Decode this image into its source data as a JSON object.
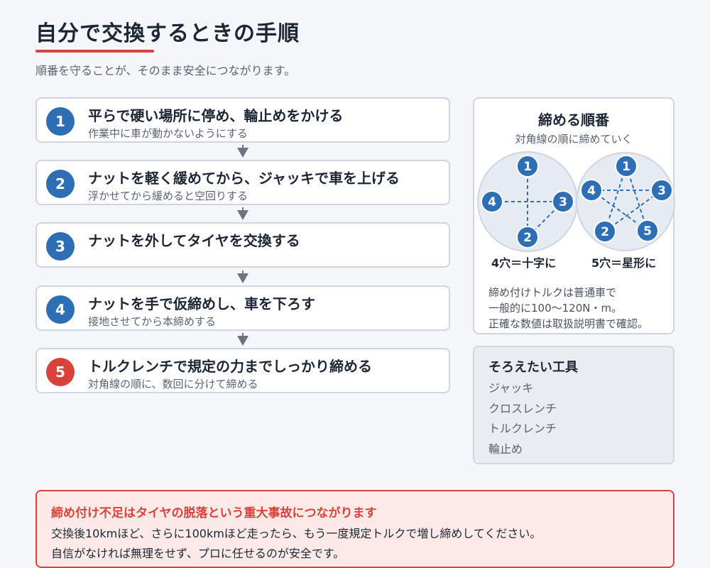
{
  "header": {
    "title": "自分で交換するときの手順",
    "subtitle": "順番を守ることが、そのまま安全につながります。"
  },
  "steps": [
    {
      "number": "1",
      "title": "平らで硬い場所に停め、輪止めをかける",
      "sub": "作業中に車が動かないようにする"
    },
    {
      "number": "2",
      "title": "ナットを軽く緩めてから、ジャッキで車を上げる",
      "sub": "浮かせてから緩めると空回りする"
    },
    {
      "number": "3",
      "title": "ナットを外してタイヤを交換する",
      "sub": ""
    },
    {
      "number": "4",
      "title": "ナットを手で仮締めし、車を下ろす",
      "sub": "接地させてから本締めする"
    },
    {
      "number": "5",
      "title": "トルクレンチで規定の力までしっかり締める",
      "sub": "対角線の順に、数回に分けて締める"
    }
  ],
  "order_panel": {
    "title": "締める順番",
    "subtitle": "対角線の順に締めていく",
    "four_hole": {
      "labels": [
        "1",
        "2",
        "3",
        "4"
      ],
      "caption": "4穴＝十字に"
    },
    "five_hole": {
      "labels": [
        "1",
        "2",
        "3",
        "4",
        "5"
      ],
      "caption": "5穴＝星形に"
    },
    "torque_lines": [
      "締め付けトルクは普通車で",
      "一般的に100〜120N・m。",
      "正確な数値は取扱説明書で確認。"
    ]
  },
  "tools": {
    "title": "そろえたい工具",
    "items": [
      "ジャッキ",
      "クロスレンチ",
      "トルクレンチ",
      "輪止め"
    ]
  },
  "warning": {
    "title": "締め付け不足はタイヤの脱落という重大事故につながります",
    "lines": [
      "交換後10kmほど、さらに100kmほど走ったら、もう一度規定トルクで増し締めしてください。",
      "自信がなければ無理をせず、プロに任せるのが安全です。"
    ]
  },
  "colors": {
    "accent_blue": "#2e6eb5",
    "accent_red": "#d9423a",
    "panel_circle": "#e6ebf2"
  }
}
